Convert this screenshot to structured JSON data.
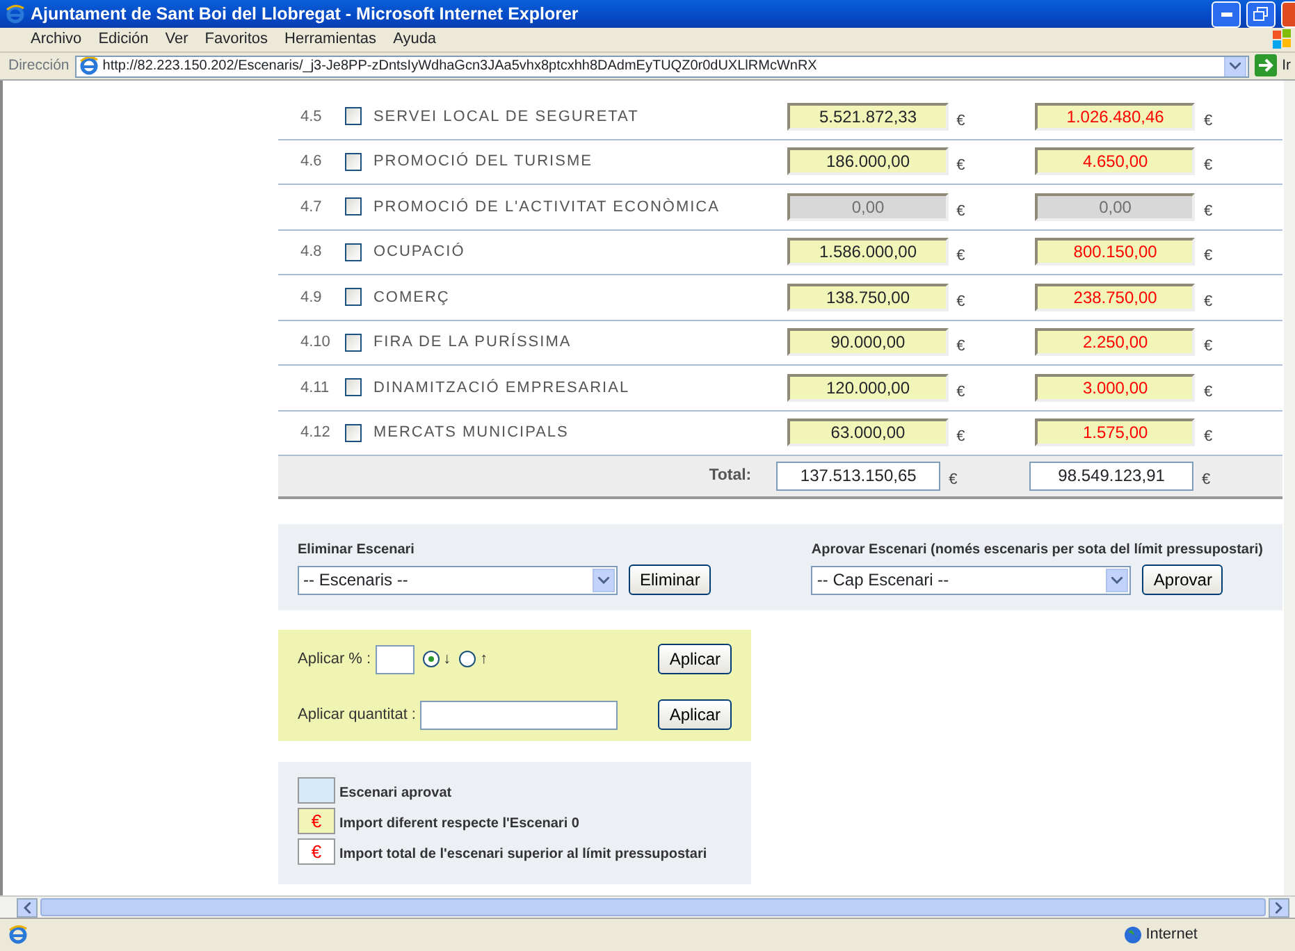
{
  "window": {
    "title": "Ajuntament de Sant Boi del Llobregat - Microsoft Internet Explorer"
  },
  "menu": [
    "Archivo",
    "Edición",
    "Ver",
    "Favoritos",
    "Herramientas",
    "Ayuda"
  ],
  "address_bar": {
    "label": "Dirección",
    "url": "http://82.223.150.202/Escenaris/_j3-Je8PP-zDntsIyWdhaGcn3JAa5vhx8ptcxhh8DAdmEyTUQZ0r0dUXLlRMcWnRX",
    "go": "Ir"
  },
  "rows": [
    {
      "number": "4.5",
      "label": "SERVEI LOCAL DE SEGURETAT",
      "checked": false,
      "disabled": false,
      "fields": [
        {
          "value": "5.521.872,33",
          "changed": true,
          "over_limit": false,
          "currency": "€"
        },
        {
          "value": "1.026.480,46",
          "changed": true,
          "over_limit": true,
          "currency": "€"
        }
      ]
    },
    {
      "number": "4.6",
      "label": "PROMOCIÓ DEL TURISME",
      "checked": false,
      "disabled": false,
      "fields": [
        {
          "value": "186.000,00",
          "changed": true,
          "over_limit": false,
          "currency": "€"
        },
        {
          "value": "4.650,00",
          "changed": true,
          "over_limit": true,
          "currency": "€"
        }
      ]
    },
    {
      "number": "4.7",
      "label": "PROMOCIÓ DE L'ACTIVITAT ECONÒMICA",
      "checked": false,
      "disabled": true,
      "fields": [
        {
          "value": "0,00",
          "changed": false,
          "over_limit": false,
          "currency": "€"
        },
        {
          "value": "0,00",
          "changed": false,
          "over_limit": false,
          "currency": "€"
        }
      ]
    },
    {
      "number": "4.8",
      "label": "OCUPACIÓ",
      "checked": false,
      "disabled": false,
      "fields": [
        {
          "value": "1.586.000,00",
          "changed": true,
          "over_limit": false,
          "currency": "€"
        },
        {
          "value": "800.150,00",
          "changed": true,
          "over_limit": true,
          "currency": "€"
        }
      ]
    },
    {
      "number": "4.9",
      "label": "COMERÇ",
      "checked": false,
      "disabled": false,
      "fields": [
        {
          "value": "138.750,00",
          "changed": true,
          "over_limit": false,
          "currency": "€"
        },
        {
          "value": "238.750,00",
          "changed": true,
          "over_limit": true,
          "currency": "€"
        }
      ]
    },
    {
      "number": "4.10",
      "label": "FIRA DE LA PURÍSSIMA",
      "checked": false,
      "disabled": false,
      "fields": [
        {
          "value": "90.000,00",
          "changed": true,
          "over_limit": false,
          "currency": "€"
        },
        {
          "value": "2.250,00",
          "changed": true,
          "over_limit": true,
          "currency": "€"
        }
      ]
    },
    {
      "number": "4.11",
      "label": "DINAMITZACIÓ EMPRESARIAL",
      "checked": false,
      "disabled": false,
      "fields": [
        {
          "value": "120.000,00",
          "changed": true,
          "over_limit": false,
          "currency": "€"
        },
        {
          "value": "3.000,00",
          "changed": true,
          "over_limit": true,
          "currency": "€"
        }
      ]
    },
    {
      "number": "4.12",
      "label": "MERCATS MUNICIPALS",
      "checked": false,
      "disabled": false,
      "fields": [
        {
          "value": "63.000,00",
          "changed": true,
          "over_limit": false,
          "currency": "€"
        },
        {
          "value": "1.575,00",
          "changed": true,
          "over_limit": true,
          "currency": "€"
        }
      ]
    }
  ],
  "total": {
    "label": "Total:",
    "fields": [
      {
        "value": "137.513.150,65",
        "currency": "€"
      },
      {
        "value": "98.549.123,91",
        "currency": "€"
      }
    ]
  },
  "delete_scenario": {
    "title": "Eliminar Escenari",
    "select": "-- Escenaris --",
    "button": "Eliminar"
  },
  "approve_scenario": {
    "title": "Aprovar Escenari (només escenaris per sota del límit pressupostari)",
    "select": "-- Cap Escenari --",
    "button": "Aprovar"
  },
  "apply_percent": {
    "label": "Aplicar % :",
    "options": [
      {
        "label": "↓",
        "selected": true
      },
      {
        "label": "↑",
        "selected": false
      }
    ],
    "button": "Aplicar"
  },
  "apply_amount": {
    "label": "Aplicar quantitat :",
    "button": "Aplicar"
  },
  "legend": [
    {
      "kind": "approved",
      "label": "Escenari aprovat"
    },
    {
      "kind": "changed",
      "symbol": "€",
      "label": "Import diferent respecte l'Escenari 0"
    },
    {
      "kind": "over_limit",
      "symbol": "€",
      "label": "Import total de l'escenari superior al límit pressupostari"
    }
  ],
  "status_bar": {
    "zone": "Internet"
  }
}
